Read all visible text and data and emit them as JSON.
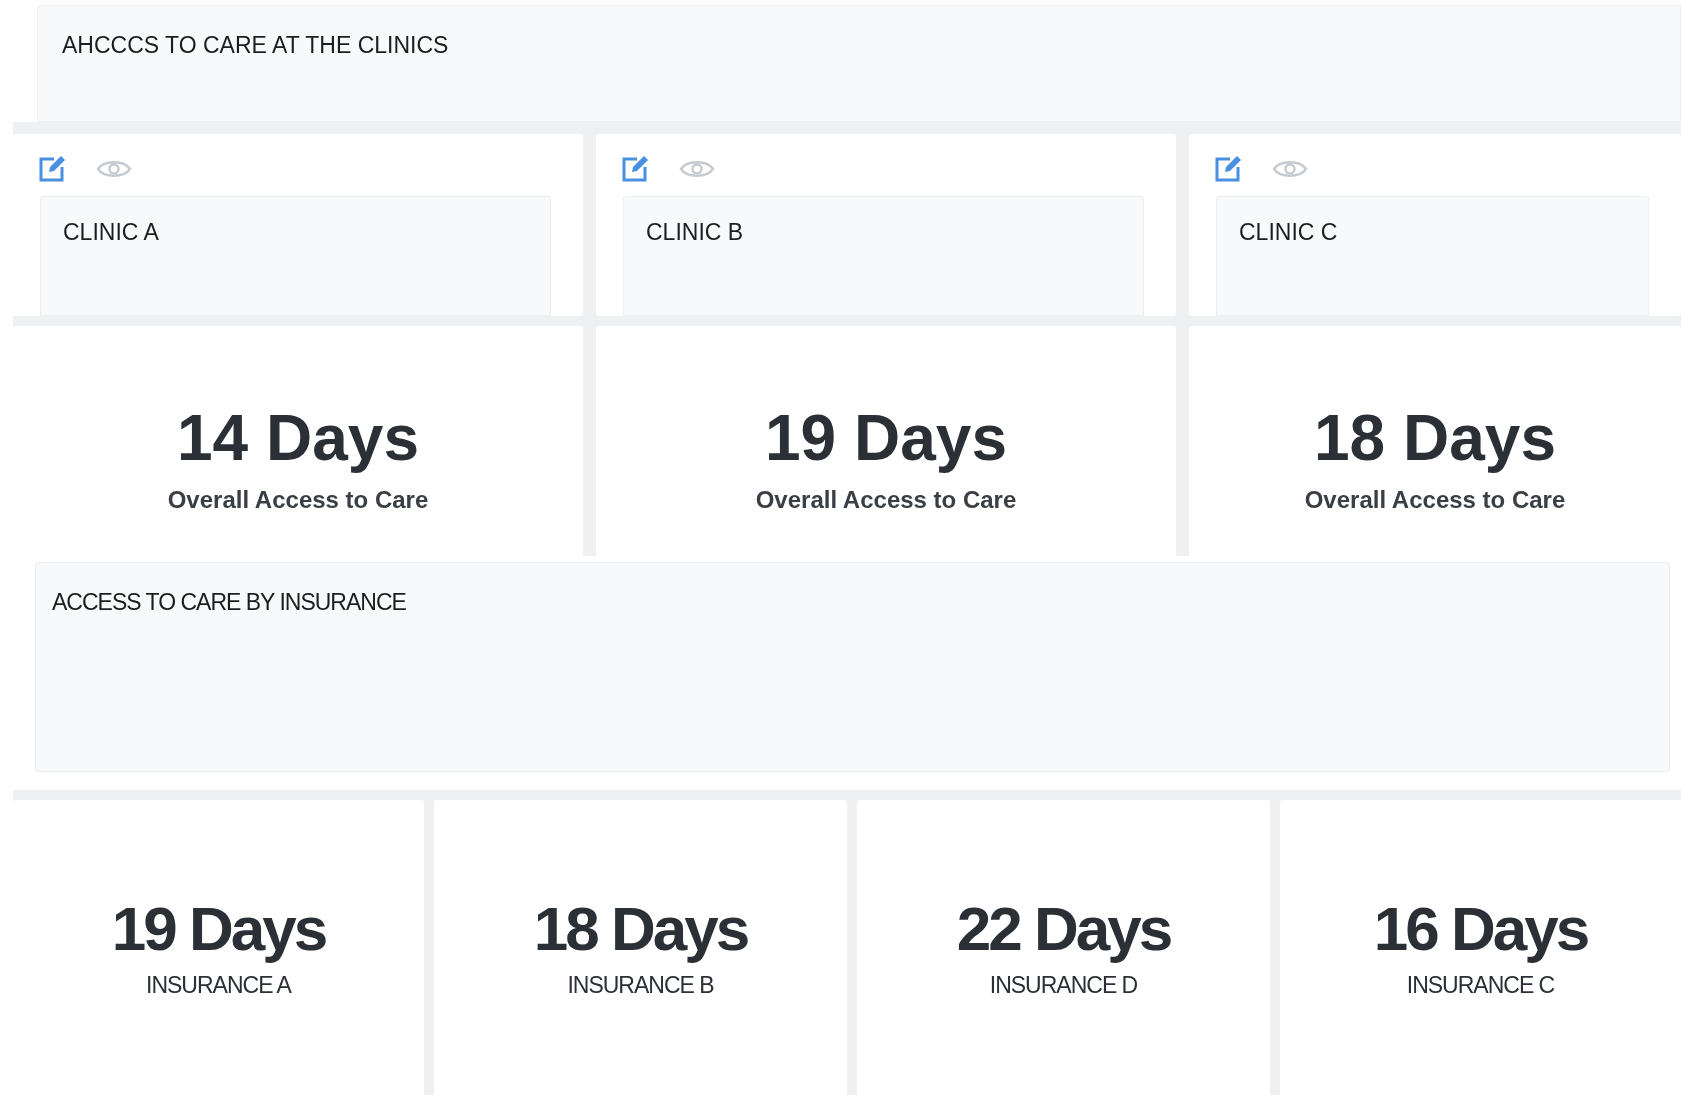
{
  "header": {
    "title": "AHCCCS TO CARE AT THE CLINICS"
  },
  "clinics": [
    {
      "name": "CLINIC A",
      "value": "14 Days",
      "caption": "Overall Access to Care"
    },
    {
      "name": "CLINIC B",
      "value": "19 Days",
      "caption": "Overall Access to Care"
    },
    {
      "name": "CLINIC C",
      "value": "18 Days",
      "caption": "Overall Access to Care"
    }
  ],
  "insurance_section": {
    "title": "ACCESS TO CARE BY INSURANCE"
  },
  "insurance": [
    {
      "value": "19 Days",
      "caption": "INSURANCE A"
    },
    {
      "value": "18 Days",
      "caption": "INSURANCE B"
    },
    {
      "value": "22 Days",
      "caption": "INSURANCE D"
    },
    {
      "value": "16 Days",
      "caption": "INSURANCE C"
    }
  ]
}
